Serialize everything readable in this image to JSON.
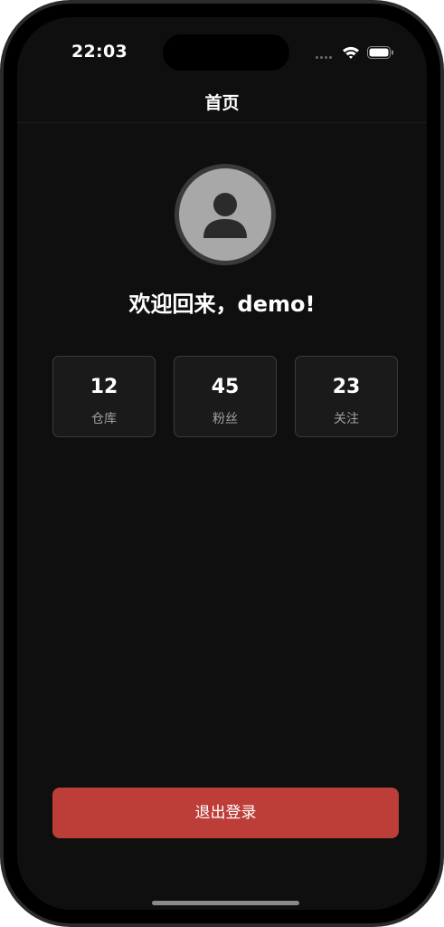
{
  "status_bar": {
    "time": "22:03",
    "icons": [
      "cellular-signal-icon",
      "wifi-icon",
      "battery-icon"
    ]
  },
  "nav": {
    "title": "首页"
  },
  "profile": {
    "avatar_icon": "person-avatar-icon",
    "welcome": "欢迎回来，demo!"
  },
  "stats": [
    {
      "value": "12",
      "label": "仓库"
    },
    {
      "value": "45",
      "label": "粉丝"
    },
    {
      "value": "23",
      "label": "关注"
    }
  ],
  "actions": {
    "logout_label": "退出登录"
  },
  "colors": {
    "background": "#0f0f0f",
    "card": "#1a1a1a",
    "danger": "#bd3e38",
    "avatar": "#a8a8a8"
  }
}
